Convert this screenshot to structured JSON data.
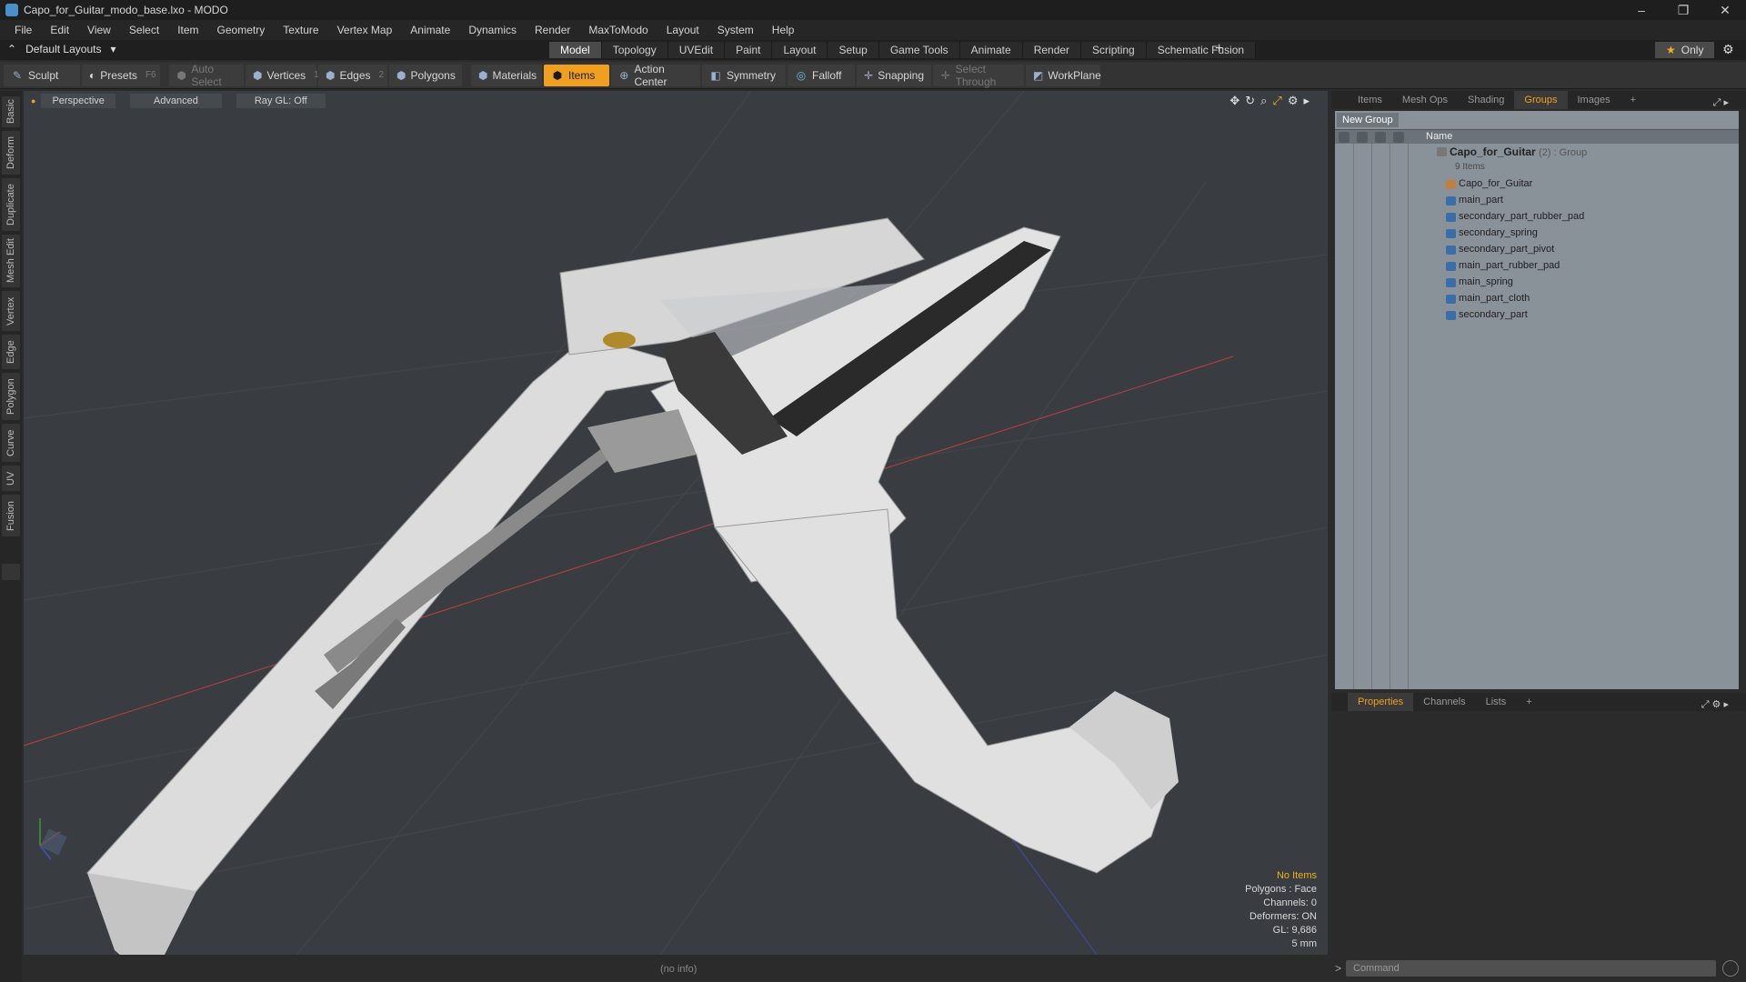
{
  "window": {
    "title": "Capo_for_Guitar_modo_base.lxo - MODO",
    "controls": [
      "–",
      "❐",
      "✕"
    ]
  },
  "menu": [
    "File",
    "Edit",
    "View",
    "Select",
    "Item",
    "Geometry",
    "Texture",
    "Vertex Map",
    "Animate",
    "Dynamics",
    "Render",
    "MaxToModo",
    "Layout",
    "System",
    "Help"
  ],
  "layout": {
    "default_layouts": "Default Layouts",
    "tabs": [
      "Model",
      "Topology",
      "UVEdit",
      "Paint",
      "Layout",
      "Setup",
      "Game Tools",
      "Animate",
      "Render",
      "Scripting",
      "Schematic Fusion"
    ],
    "active_tab": "Model",
    "add": "+",
    "only": "Only"
  },
  "toolbar": {
    "sculpt": "Sculpt",
    "presets": "Presets",
    "presets_key": "F6",
    "auto_select": "Auto Select",
    "vertices": "Vertices",
    "vertices_count": "1",
    "edges": "Edges",
    "edges_count": "2",
    "polygons": "Polygons",
    "materials": "Materials",
    "items": "Items",
    "action_center": "Action Center",
    "symmetry": "Symmetry",
    "falloff": "Falloff",
    "snapping": "Snapping",
    "select_through": "Select Through",
    "workplane": "WorkPlane"
  },
  "left_tabs": [
    "Basic",
    "Deform",
    "Duplicate",
    "Mesh Edit",
    "Vertex",
    "Edge",
    "Polygon",
    "Curve",
    "UV",
    "Fusion"
  ],
  "viewport": {
    "view": "Perspective",
    "shading": "Advanced",
    "raygl": "Ray GL: Off",
    "info": {
      "items": "No Items",
      "polygons": "Polygons : Face",
      "channels": "Channels: 0",
      "deformers": "Deformers: ON",
      "gl": "GL: 9,686",
      "unit": "5 mm"
    }
  },
  "status": "(no info)",
  "right_panel": {
    "top_tabs": [
      "Items",
      "Mesh Ops",
      "Shading",
      "Groups",
      "Images"
    ],
    "active_top_tab": "Groups",
    "new_group": "New Group",
    "name_header": "Name",
    "group": {
      "name": "Capo_for_Guitar",
      "meta": "(2) : Group",
      "count": "9 Items"
    },
    "items": [
      "Capo_for_Guitar",
      "main_part",
      "secondary_part_rubber_pad",
      "secondary_spring",
      "secondary_part_pivot",
      "main_part_rubber_pad",
      "main_spring",
      "main_part_cloth",
      "secondary_part"
    ],
    "bottom_tabs": [
      "Properties",
      "Channels",
      "Lists"
    ],
    "active_bottom_tab": "Properties",
    "command_placeholder": "Command"
  },
  "colors": {
    "accent": "#f0a020",
    "viewport_bg": "#393d41",
    "grid_line": "#464b50",
    "model": "#e4e4e4",
    "x_axis": "#c04040",
    "z_axis": "#4050c0"
  }
}
